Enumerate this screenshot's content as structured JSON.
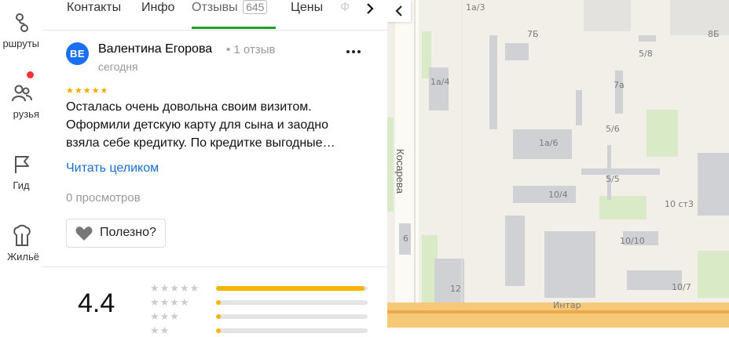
{
  "rail": [
    {
      "label": "ршруты",
      "icon": "routes-icon"
    },
    {
      "label": "рузья",
      "icon": "friends-icon"
    },
    {
      "label": "Гид",
      "icon": "guide-flag-icon"
    },
    {
      "label": "Жильё",
      "icon": "housing-icon"
    }
  ],
  "tabs": {
    "items": [
      "Контакты",
      "Инфо",
      "Отзывы",
      "Цены",
      "Ф"
    ],
    "reviews_count": "645",
    "active": "Отзывы"
  },
  "review": {
    "avatar_initials": "ВЕ",
    "author": "Валентина Егорова",
    "author_meta": "• 1 отзыв",
    "date": "сегодня",
    "stars": "★★★★★",
    "text_lines": [
      "Осталась очень довольна своим визитом.",
      "Оформили детскую карту для сына и заодно",
      "взяла себе кредитку. По кредитке выгодные…"
    ],
    "read_more": "Читать целиком",
    "views": "0 просмотров",
    "helpful": "Полезно?"
  },
  "rating": {
    "value": "4.4",
    "rows": [
      {
        "stars": "★★★★★",
        "fraction": 0.98
      },
      {
        "stars": "★★★★",
        "fraction": 0.03
      },
      {
        "stars": "★★★",
        "fraction": 0.02
      },
      {
        "stars": "★★",
        "fraction": 0.01
      }
    ]
  },
  "map": {
    "street": "Косарева",
    "labels": [
      "1а/3",
      "7Б",
      "8Б",
      "5/8",
      "1а/4",
      "7а",
      "5/6",
      "1а/6",
      "5/5",
      "10/4",
      "10 ст3",
      "6",
      "10/10",
      "12",
      "Интар",
      "10/7"
    ]
  },
  "colors": {
    "accent_tab": "#22a02b",
    "link": "#1a6fc7",
    "star": "#f7a800",
    "avatar": "#1a6ff0"
  }
}
